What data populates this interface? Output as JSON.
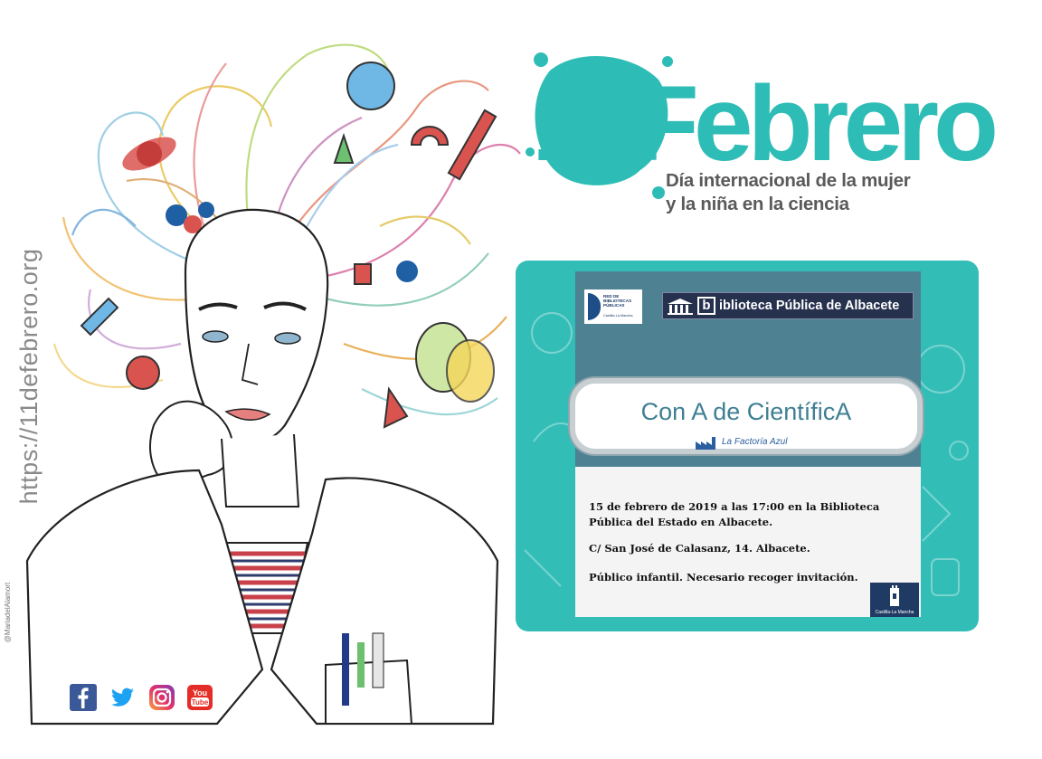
{
  "side_url": "https://11defebrero.org",
  "credit": "@MariadelAlamort",
  "title": {
    "big": "11Febrero",
    "line1": "Día internacional de la mujer",
    "line2": "y la niña en la ciencia"
  },
  "card": {
    "logo_red_text": "RED DE BIBLIOTECAS PÚBLICAS",
    "logo_red_sub": "Castilla-La Mancha",
    "library_letter": "b",
    "library_name": "iblioteca Pública de Albacete",
    "event_title": "Con A de CientíficA",
    "organizer": "La Factoría Azul",
    "info": [
      "15 de febrero de 2019 a las 17:00 en la Biblioteca Pública del Estado en Albacete.",
      "C/ San José de Calasanz, 14. Albacete.",
      "Público infantil. Necesario recoger invitación."
    ],
    "region_logo": "Castilla-La Mancha"
  },
  "social": [
    "facebook-icon",
    "twitter-icon",
    "instagram-icon",
    "youtube-icon"
  ],
  "youtube_text": [
    "You",
    "Tube"
  ],
  "colors": {
    "teal": "#2ebdb6",
    "card_teal": "#33bdb7",
    "card_inner": "#4e8191",
    "navy": "#26314e",
    "title_gray": "#5a5a5a"
  }
}
